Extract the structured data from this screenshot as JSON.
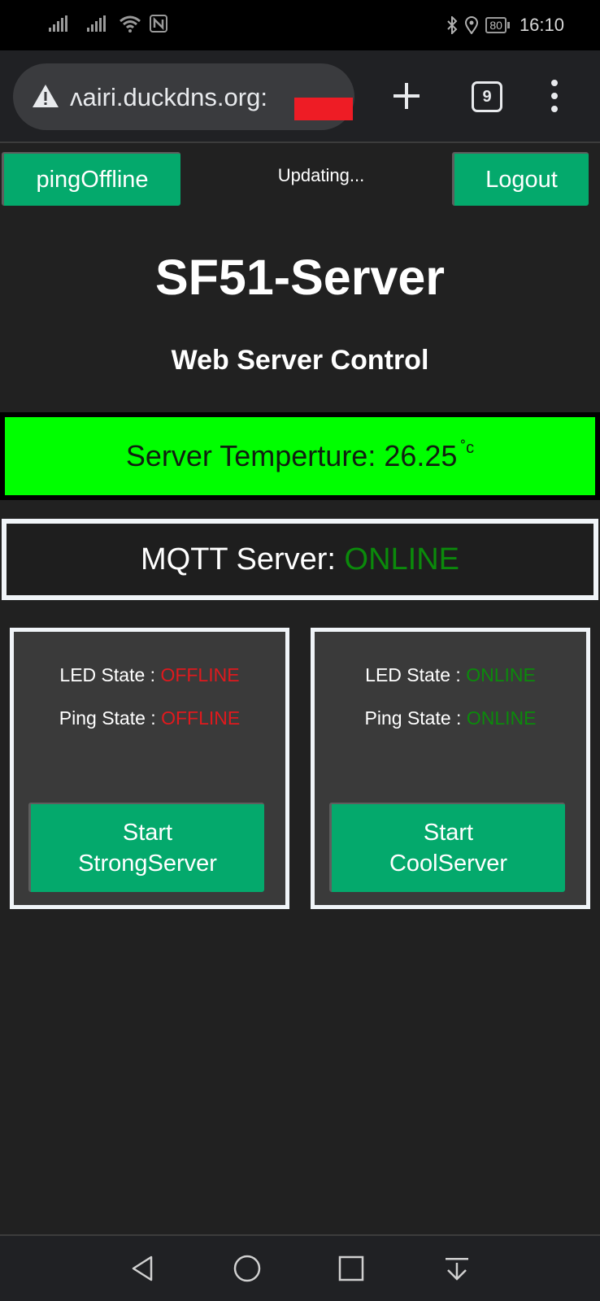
{
  "status_bar": {
    "battery": "80",
    "time": "16:10",
    "icons": [
      "signal-icon",
      "signal-icon",
      "wifi-icon",
      "nfc-icon",
      "bluetooth-icon",
      "location-icon",
      "battery-icon"
    ]
  },
  "browser": {
    "url": "ʌairi.duckdns.org:",
    "tab_count": "9",
    "icons": [
      "warning-icon",
      "new-tab-icon",
      "tab-switcher-icon",
      "overflow-menu-icon"
    ]
  },
  "header": {
    "ping_button": "pingOffline",
    "status_text": "Updating...",
    "logout_button": "Logout"
  },
  "page": {
    "title": "SF51-Server",
    "subtitle": "Web Server Control"
  },
  "temperature": {
    "label": "Server Temperture: ",
    "value": "26.25",
    "unit": "˚c",
    "box_color": "#00ff00"
  },
  "mqtt": {
    "label": "MQTT Server: ",
    "status": "ONLINE"
  },
  "servers": [
    {
      "led_label": "LED State : ",
      "led_state": "OFFLINE",
      "ping_label": "Ping State : ",
      "ping_state": "OFFLINE",
      "button_line1": "Start",
      "button_line2": "StrongServer"
    },
    {
      "led_label": "LED State : ",
      "led_state": "ONLINE",
      "ping_label": "Ping State : ",
      "ping_state": "ONLINE",
      "button_line1": "Start",
      "button_line2": "CoolServer"
    }
  ],
  "colors": {
    "accent_button": "#04a96c",
    "online": "#0b8a0b",
    "offline": "#e0191d"
  },
  "nav_bar": {
    "icons": [
      "back-icon",
      "home-icon",
      "recents-icon",
      "notification-shade-icon"
    ]
  }
}
